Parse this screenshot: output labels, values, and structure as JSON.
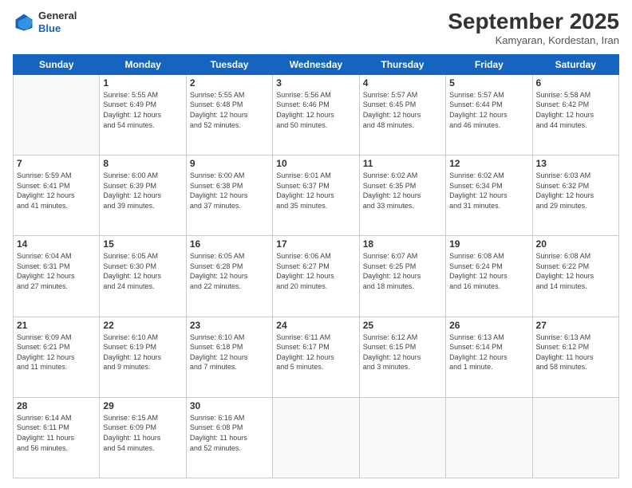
{
  "header": {
    "logo": {
      "general": "General",
      "blue": "Blue"
    },
    "month": "September 2025",
    "location": "Kamyaran, Kordestan, Iran"
  },
  "weekdays": [
    "Sunday",
    "Monday",
    "Tuesday",
    "Wednesday",
    "Thursday",
    "Friday",
    "Saturday"
  ],
  "weeks": [
    [
      {
        "day": "",
        "info": ""
      },
      {
        "day": "1",
        "info": "Sunrise: 5:55 AM\nSunset: 6:49 PM\nDaylight: 12 hours\nand 54 minutes."
      },
      {
        "day": "2",
        "info": "Sunrise: 5:55 AM\nSunset: 6:48 PM\nDaylight: 12 hours\nand 52 minutes."
      },
      {
        "day": "3",
        "info": "Sunrise: 5:56 AM\nSunset: 6:46 PM\nDaylight: 12 hours\nand 50 minutes."
      },
      {
        "day": "4",
        "info": "Sunrise: 5:57 AM\nSunset: 6:45 PM\nDaylight: 12 hours\nand 48 minutes."
      },
      {
        "day": "5",
        "info": "Sunrise: 5:57 AM\nSunset: 6:44 PM\nDaylight: 12 hours\nand 46 minutes."
      },
      {
        "day": "6",
        "info": "Sunrise: 5:58 AM\nSunset: 6:42 PM\nDaylight: 12 hours\nand 44 minutes."
      }
    ],
    [
      {
        "day": "7",
        "info": "Sunrise: 5:59 AM\nSunset: 6:41 PM\nDaylight: 12 hours\nand 41 minutes."
      },
      {
        "day": "8",
        "info": "Sunrise: 6:00 AM\nSunset: 6:39 PM\nDaylight: 12 hours\nand 39 minutes."
      },
      {
        "day": "9",
        "info": "Sunrise: 6:00 AM\nSunset: 6:38 PM\nDaylight: 12 hours\nand 37 minutes."
      },
      {
        "day": "10",
        "info": "Sunrise: 6:01 AM\nSunset: 6:37 PM\nDaylight: 12 hours\nand 35 minutes."
      },
      {
        "day": "11",
        "info": "Sunrise: 6:02 AM\nSunset: 6:35 PM\nDaylight: 12 hours\nand 33 minutes."
      },
      {
        "day": "12",
        "info": "Sunrise: 6:02 AM\nSunset: 6:34 PM\nDaylight: 12 hours\nand 31 minutes."
      },
      {
        "day": "13",
        "info": "Sunrise: 6:03 AM\nSunset: 6:32 PM\nDaylight: 12 hours\nand 29 minutes."
      }
    ],
    [
      {
        "day": "14",
        "info": "Sunrise: 6:04 AM\nSunset: 6:31 PM\nDaylight: 12 hours\nand 27 minutes."
      },
      {
        "day": "15",
        "info": "Sunrise: 6:05 AM\nSunset: 6:30 PM\nDaylight: 12 hours\nand 24 minutes."
      },
      {
        "day": "16",
        "info": "Sunrise: 6:05 AM\nSunset: 6:28 PM\nDaylight: 12 hours\nand 22 minutes."
      },
      {
        "day": "17",
        "info": "Sunrise: 6:06 AM\nSunset: 6:27 PM\nDaylight: 12 hours\nand 20 minutes."
      },
      {
        "day": "18",
        "info": "Sunrise: 6:07 AM\nSunset: 6:25 PM\nDaylight: 12 hours\nand 18 minutes."
      },
      {
        "day": "19",
        "info": "Sunrise: 6:08 AM\nSunset: 6:24 PM\nDaylight: 12 hours\nand 16 minutes."
      },
      {
        "day": "20",
        "info": "Sunrise: 6:08 AM\nSunset: 6:22 PM\nDaylight: 12 hours\nand 14 minutes."
      }
    ],
    [
      {
        "day": "21",
        "info": "Sunrise: 6:09 AM\nSunset: 6:21 PM\nDaylight: 12 hours\nand 11 minutes."
      },
      {
        "day": "22",
        "info": "Sunrise: 6:10 AM\nSunset: 6:19 PM\nDaylight: 12 hours\nand 9 minutes."
      },
      {
        "day": "23",
        "info": "Sunrise: 6:10 AM\nSunset: 6:18 PM\nDaylight: 12 hours\nand 7 minutes."
      },
      {
        "day": "24",
        "info": "Sunrise: 6:11 AM\nSunset: 6:17 PM\nDaylight: 12 hours\nand 5 minutes."
      },
      {
        "day": "25",
        "info": "Sunrise: 6:12 AM\nSunset: 6:15 PM\nDaylight: 12 hours\nand 3 minutes."
      },
      {
        "day": "26",
        "info": "Sunrise: 6:13 AM\nSunset: 6:14 PM\nDaylight: 12 hours\nand 1 minute."
      },
      {
        "day": "27",
        "info": "Sunrise: 6:13 AM\nSunset: 6:12 PM\nDaylight: 11 hours\nand 58 minutes."
      }
    ],
    [
      {
        "day": "28",
        "info": "Sunrise: 6:14 AM\nSunset: 6:11 PM\nDaylight: 11 hours\nand 56 minutes."
      },
      {
        "day": "29",
        "info": "Sunrise: 6:15 AM\nSunset: 6:09 PM\nDaylight: 11 hours\nand 54 minutes."
      },
      {
        "day": "30",
        "info": "Sunrise: 6:16 AM\nSunset: 6:08 PM\nDaylight: 11 hours\nand 52 minutes."
      },
      {
        "day": "",
        "info": ""
      },
      {
        "day": "",
        "info": ""
      },
      {
        "day": "",
        "info": ""
      },
      {
        "day": "",
        "info": ""
      }
    ]
  ]
}
